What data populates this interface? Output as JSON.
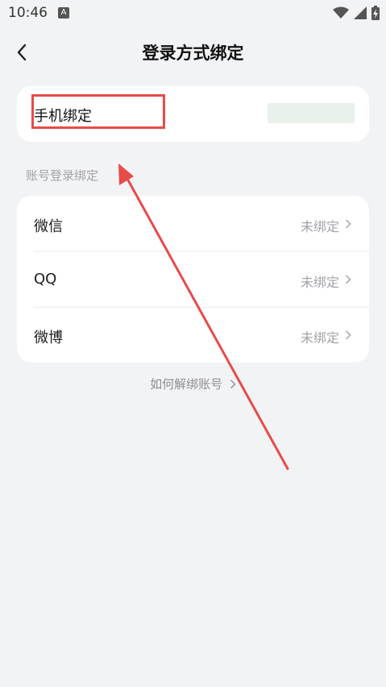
{
  "status_bar": {
    "time": "10:46",
    "badge": "A"
  },
  "nav": {
    "title": "登录方式绑定"
  },
  "phone": {
    "label": "手机绑定"
  },
  "section": {
    "label": "账号登录绑定"
  },
  "accounts": [
    {
      "name": "微信",
      "status": "未绑定"
    },
    {
      "name": "QQ",
      "status": "未绑定"
    },
    {
      "name": "微博",
      "status": "未绑定"
    }
  ],
  "help": {
    "label": "如何解绑账号"
  },
  "colors": {
    "annotation": "#e84a4a",
    "background": "#f2f3f5"
  }
}
